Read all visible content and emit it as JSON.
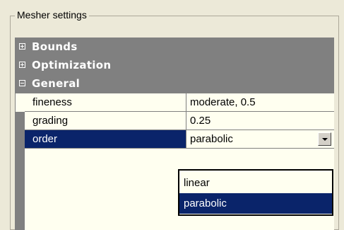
{
  "group_title": "Mesher settings",
  "categories": [
    {
      "label": "Bounds",
      "expander": "+"
    },
    {
      "label": "Optimization",
      "expander": "+"
    },
    {
      "label": "General",
      "expander": "-"
    }
  ],
  "properties": [
    {
      "name": "fineness",
      "value": "moderate, 0.5"
    },
    {
      "name": "grading",
      "value": "0.25"
    },
    {
      "name": "order",
      "value": "parabolic"
    }
  ],
  "dropdown_options": [
    {
      "label": "linear",
      "selected": false
    },
    {
      "label": "parabolic",
      "selected": true
    }
  ],
  "colors": {
    "selection": "#0a246a",
    "category_bg": "#808080",
    "grid_bg": "#fffff0",
    "window_bg": "#ece9d8"
  }
}
